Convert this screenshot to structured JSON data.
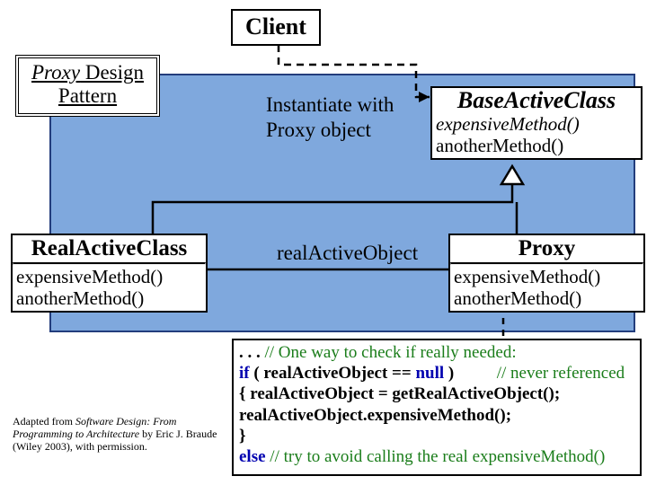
{
  "pattern": {
    "line1": "Proxy",
    "line2_a": " Design",
    "line3": "Pattern"
  },
  "client": {
    "title": "Client"
  },
  "notes": {
    "inst1": "Instantiate with",
    "inst2": "Proxy object",
    "assoc": "realActiveObject"
  },
  "base": {
    "title": "BaseActiveClass",
    "ops": [
      "expensiveMethod()",
      "anotherMethod()"
    ]
  },
  "real": {
    "title": "RealActiveClass",
    "ops": [
      "expensiveMethod()",
      "anotherMethod()"
    ]
  },
  "proxy": {
    "title": "Proxy",
    "ops": [
      "expensiveMethod()",
      "anotherMethod()"
    ]
  },
  "code": {
    "l1_dots": ". . . ",
    "l1_cmt": "// One way to check if really needed:",
    "l2_if": "if",
    "l2_body": " ( realActiveObject == ",
    "l2_null": "null",
    "l2_close": " ) ",
    "l2_cmt": "// never referenced",
    "l3": "{     realActiveObject = getRealActiveObject();",
    "l4": "       realActiveObject.expensiveMethod();",
    "l5": "}",
    "l6_else": "else",
    "l6_cmt": " // try to avoid calling the real expensiveMethod()"
  },
  "attrib": {
    "t1": "Adapted from ",
    "t2": "Software Design: From Programming to Architecture",
    "t3": " by Eric J. Braude (Wiley 2003), with permission."
  }
}
